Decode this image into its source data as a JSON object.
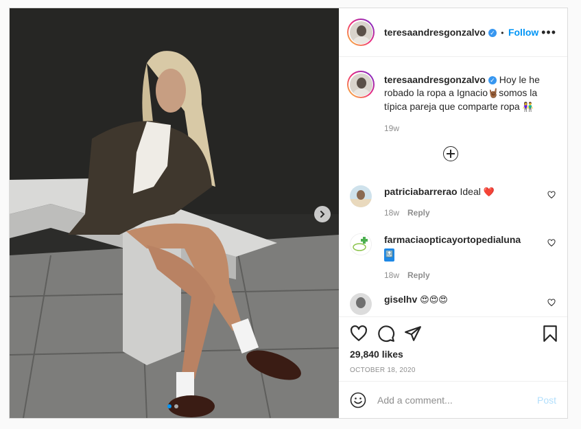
{
  "post": {
    "username": "teresaandresgonzalvo",
    "verified": true,
    "separator": "•",
    "follow_label": "Follow",
    "more_label": "•••",
    "caption": {
      "text_a": "Hoy le he robado la ropa a Ignacio",
      "emoji_a": "🤘🏾",
      "text_b": "somos la típica pareja que comparte ropa ",
      "emoji_b": "👫",
      "time": "19w"
    },
    "comments": [
      {
        "username": "patriciabarrerao",
        "text": "Ideal ",
        "emoji": "❤️",
        "time": "18w",
        "reply_label": "Reply"
      },
      {
        "username": "farmaciaopticayortopedialuna",
        "text": "",
        "emoji": "🔝",
        "time": "18w",
        "reply_label": "Reply"
      },
      {
        "username": "giselhv",
        "text": "",
        "emoji": "😍😍😍",
        "time": "",
        "reply_label": ""
      }
    ],
    "likes_text": "29,840 likes",
    "date_text": "OCTOBER 18, 2020",
    "comment_placeholder": "Add a comment...",
    "post_label": "Post",
    "carousel": {
      "slides": 2,
      "active_index": 0
    }
  },
  "colors": {
    "accent": "#0095f6",
    "verified": "#3897f0",
    "heart_red": "#ed4956",
    "post_disabled": "#b2dffc"
  },
  "icons": [
    "heart-icon",
    "comment-icon",
    "share-icon",
    "bookmark-icon",
    "emoji-icon",
    "chevron-right-icon",
    "add-circle-icon"
  ]
}
